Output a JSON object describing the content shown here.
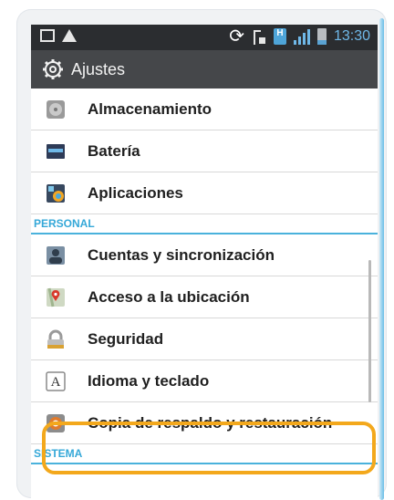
{
  "status_bar": {
    "time": "13:30"
  },
  "action_bar": {
    "title": "Ajustes"
  },
  "items": [
    {
      "label": "Almacenamiento",
      "icon": "storage-icon"
    },
    {
      "label": "Batería",
      "icon": "battery-icon"
    },
    {
      "label": "Aplicaciones",
      "icon": "apps-icon"
    }
  ],
  "section_personal": "PERSONAL",
  "personal_items": [
    {
      "label": "Cuentas y sincronización",
      "icon": "accounts-icon"
    },
    {
      "label": "Acceso a la ubicación",
      "icon": "location-icon"
    },
    {
      "label": "Seguridad",
      "icon": "lock-icon"
    },
    {
      "label": "Idioma y teclado",
      "icon": "keyboard-icon",
      "glyph": "A"
    },
    {
      "label": "Copia de respaldo y restauración",
      "icon": "backup-icon"
    }
  ],
  "section_sistema": "SISTEMA",
  "colors": {
    "section_text": "#35a8d8",
    "highlight": "#f3a81c",
    "action_bar": "#45474a"
  }
}
